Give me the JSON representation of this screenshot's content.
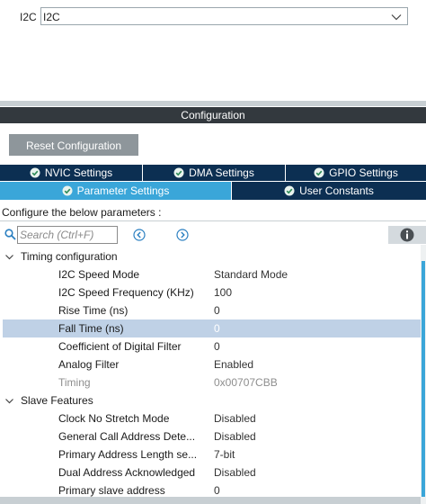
{
  "mode": {
    "label": "I2C",
    "selected": "I2C"
  },
  "configuration_title": "Configuration",
  "reset_button": "Reset Configuration",
  "tabs_row1": [
    {
      "label": "NVIC Settings"
    },
    {
      "label": "DMA Settings"
    },
    {
      "label": "GPIO Settings"
    }
  ],
  "tabs_row2": [
    {
      "label": "Parameter Settings",
      "active": true
    },
    {
      "label": "User Constants"
    }
  ],
  "hint": "Configure the below parameters :",
  "search": {
    "placeholder": "Search (Ctrl+F)"
  },
  "groups": [
    {
      "label": "Timing configuration",
      "params": [
        {
          "name": "I2C Speed Mode",
          "value": "Standard Mode"
        },
        {
          "name": "I2C Speed Frequency (KHz)",
          "value": "100"
        },
        {
          "name": "Rise Time (ns)",
          "value": "0"
        },
        {
          "name": "Fall Time (ns)",
          "value": "0"
        },
        {
          "name": "Coefficient of Digital Filter",
          "value": "0"
        },
        {
          "name": "Analog Filter",
          "value": "Enabled"
        },
        {
          "name": "Timing",
          "value": "0x00707CBB"
        }
      ]
    },
    {
      "label": "Slave Features",
      "params": [
        {
          "name": "Clock No Stretch Mode",
          "value": "Disabled"
        },
        {
          "name": "General Call Address Dete...",
          "value": "Disabled"
        },
        {
          "name": "Primary Address Length se...",
          "value": "7-bit"
        },
        {
          "name": "Dual Address Acknowledged",
          "value": "Disabled"
        },
        {
          "name": "Primary slave address",
          "value": "0"
        }
      ]
    }
  ],
  "colors": {
    "tab_dark": "#0c2f52",
    "tab_active": "#3aa6d9",
    "header_bar": "#33393e",
    "selected_row": "#bfd1e6"
  }
}
